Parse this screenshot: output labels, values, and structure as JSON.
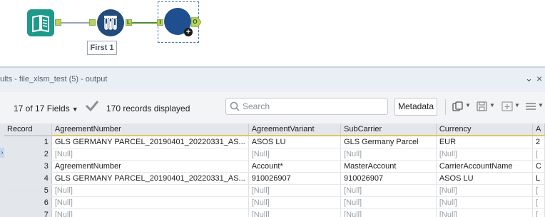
{
  "workflow": {
    "annotation": "First 1",
    "sample_output_anchor": "L",
    "browse_input_anchor": "I",
    "browse_output_anchor": "O"
  },
  "results": {
    "title": "ults - file_xlsm_test (5) - output",
    "fields_label": "17 of 17 Fields",
    "records_label": "170 records displayed",
    "search_placeholder": "Search",
    "metadata_label": "Metadata",
    "columns": [
      "Record",
      "AgreementNumber",
      "AgreementVariant",
      "SubCarrier",
      "Currency",
      "A"
    ],
    "rows": [
      [
        "1",
        "GLS GERMANY PARCEL_20190401_20220331_AS...",
        "ASOS LU",
        "GLS Germany Parcel",
        "EUR",
        "2"
      ],
      [
        "2",
        "[Null]",
        "[Null]",
        "[Null]",
        "[Null]",
        "["
      ],
      [
        "3",
        "AgreementNumber",
        "Account*",
        "MasterAccount",
        "CarrierAccountName",
        "C"
      ],
      [
        "4",
        "GLS GERMANY PARCEL_20190401_20220331_AS...",
        "910026907",
        "910026907",
        "ASOS LU",
        "L"
      ],
      [
        "5",
        "[Null]",
        "[Null]",
        "[Null]",
        "[Null]",
        "["
      ],
      [
        "6",
        "[Null]",
        "[Null]",
        "[Null]",
        "[Null]",
        "["
      ],
      [
        "7",
        "[Null]",
        "[Null]",
        "[Null]",
        "[Null]",
        "["
      ]
    ]
  },
  "icons": {
    "input": "book-input-icon",
    "sample": "test-tubes-icon",
    "browse": "browse-circle-icon",
    "check": "checkmark-icon",
    "search": "search-icon",
    "copy": "copy-icon",
    "save": "save-icon",
    "add_column": "add-column-icon",
    "menu": "hamburger-menu-icon"
  },
  "colors": {
    "input_tool": "#1e9a8a",
    "sample_tool": "#234c7a",
    "browse_tool": "#1f4f8f",
    "anchor": "#b5d35d",
    "header_underline": "#e3c55b"
  }
}
